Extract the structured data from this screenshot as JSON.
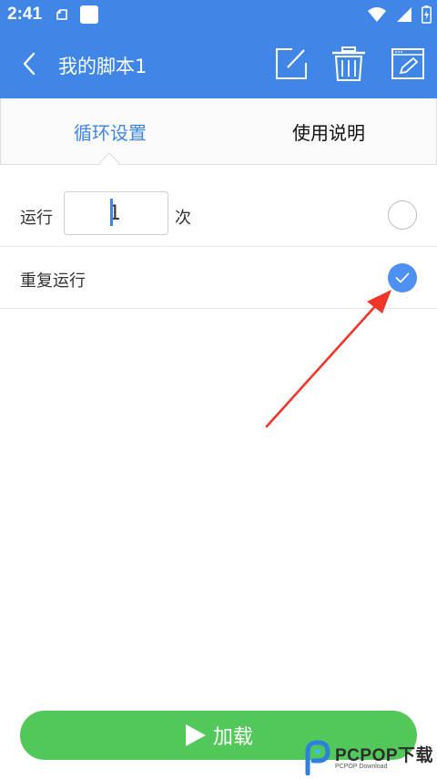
{
  "status_bar": {
    "time": "2:41"
  },
  "nav": {
    "title": "我的脚本1"
  },
  "tabs": [
    {
      "label": "循环设置",
      "active": true
    },
    {
      "label": "使用说明",
      "active": false
    }
  ],
  "settings": {
    "run_label": "运行",
    "run_count": "1",
    "times_label": "次",
    "run_selected": false,
    "repeat_label": "重复运行",
    "repeat_selected": true
  },
  "load_button": {
    "label": "加载"
  },
  "watermark": {
    "brand": "PCPOP下载",
    "sub": "PCPOP Download"
  },
  "colors": {
    "header": "#3f86e6",
    "accent": "#4e8ff2",
    "load_button": "#52c85a",
    "annotation_arrow": "#f0352a"
  }
}
